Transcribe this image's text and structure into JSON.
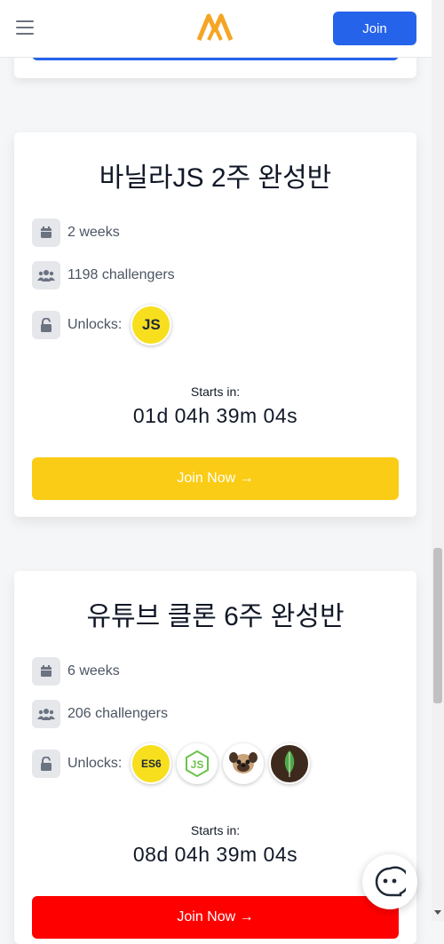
{
  "header": {
    "join_label": "Join"
  },
  "courses": [
    {
      "title": "바닐라JS 2주 완성반",
      "duration": "2 weeks",
      "challengers": "1198 challengers",
      "unlocks_label": "Unlocks:",
      "badges": [
        "JS"
      ],
      "starts_label": "Starts in:",
      "countdown": "01d 04h 39m 04s",
      "cta_label": "Join Now →",
      "cta_color": "#facc15"
    },
    {
      "title": "유튜브 클론 6주 완성반",
      "duration": "6 weeks",
      "challengers": "206 challengers",
      "unlocks_label": "Unlocks:",
      "badges": [
        "ES6",
        "nodejs",
        "pug",
        "mongodb"
      ],
      "starts_label": "Starts in:",
      "countdown": "08d 04h 39m 04s",
      "cta_label": "Join Now →",
      "cta_color": "#ff0000"
    }
  ],
  "colors": {
    "primary": "#2563eb",
    "js_yellow": "#f7df1e",
    "node_green": "#6cc24a",
    "mongo_green": "#4fa94d",
    "mongo_bg": "#3e2a1d"
  }
}
